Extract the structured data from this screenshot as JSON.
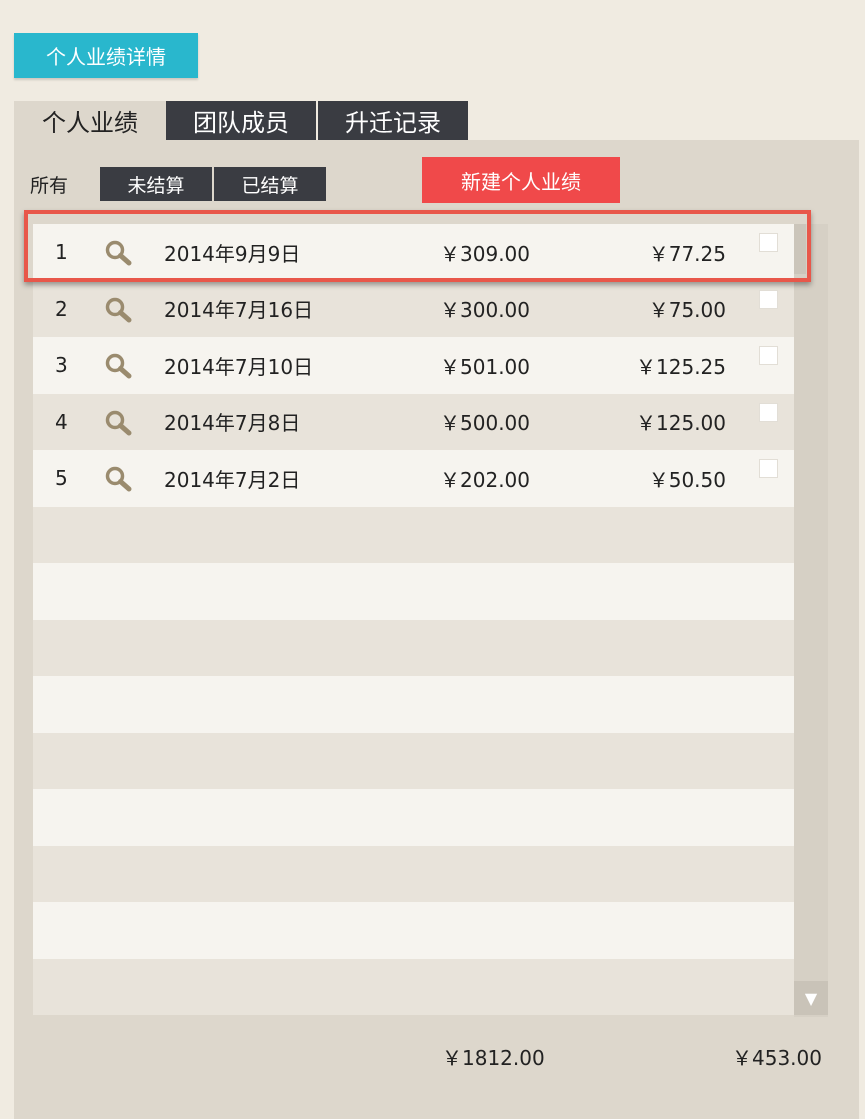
{
  "header": {
    "title_button": "个人业绩详情"
  },
  "tabs": [
    {
      "label": "个人业绩",
      "active": true
    },
    {
      "label": "团队成员",
      "active": false
    },
    {
      "label": "升迁记录",
      "active": false
    }
  ],
  "filters": {
    "all_label": "所有",
    "unsettled_label": "未结算",
    "settled_label": "已结算"
  },
  "new_button": {
    "label": "新建个人业绩"
  },
  "rows": [
    {
      "num": "1",
      "date": "2014年9月9日",
      "amount": "￥309.00",
      "commission": "￥77.25"
    },
    {
      "num": "2",
      "date": "2014年7月16日",
      "amount": "￥300.00",
      "commission": "￥75.00"
    },
    {
      "num": "3",
      "date": "2014年7月10日",
      "amount": "￥501.00",
      "commission": "￥125.25"
    },
    {
      "num": "4",
      "date": "2014年7月8日",
      "amount": "￥500.00",
      "commission": "￥125.00"
    },
    {
      "num": "5",
      "date": "2014年7月2日",
      "amount": "￥202.00",
      "commission": "￥50.50"
    }
  ],
  "totals": {
    "amount": "￥1812.00",
    "commission": "￥453.00"
  },
  "colors": {
    "accent": "#29b7cd",
    "new_button": "#f0494a",
    "highlight": "#e8574a",
    "dark_tab": "#3a3c42"
  },
  "icons": {
    "row_action": "magnifier-icon",
    "scroll_down": "down-triangle-icon"
  }
}
